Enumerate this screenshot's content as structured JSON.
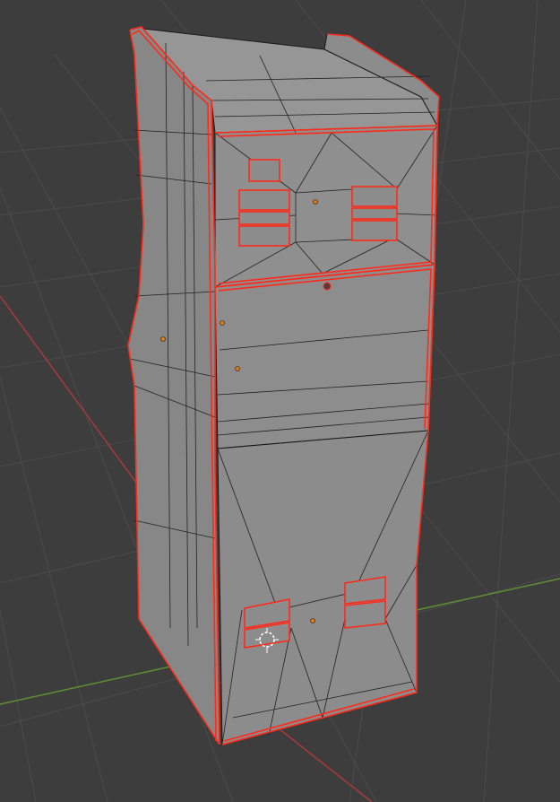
{
  "viewport": {
    "background": "#3d3d3d",
    "grid_color": "#4a4a4a",
    "x_axis_color": "#b23b3b",
    "y_axis_color": "#6a9a3a"
  },
  "model": {
    "face_color": "#8f8f8f",
    "face_light": "#9a9a9a",
    "face_dark": "#848484",
    "wire_color": "#1a1a1a",
    "selection_color": "#ff2a1a",
    "origin_color": "#e07b1a"
  },
  "icons": {
    "cursor": "3d-cursor-icon",
    "origin": "object-origin-icon"
  }
}
